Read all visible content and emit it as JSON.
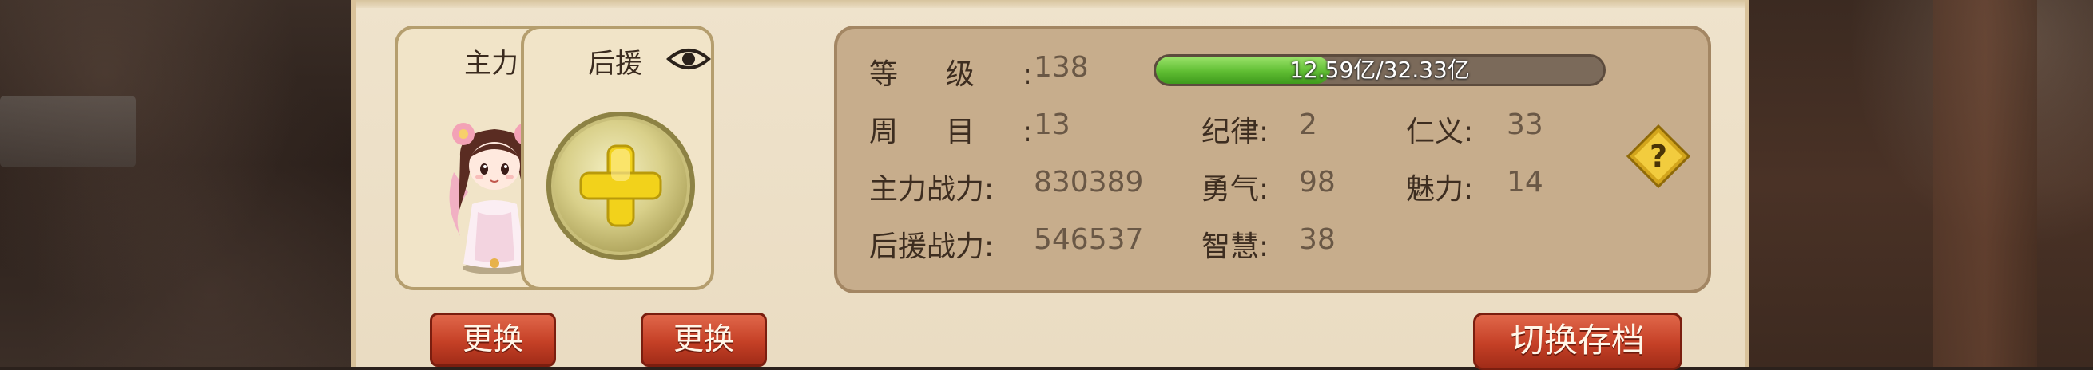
{
  "cards": {
    "main_label": "主力",
    "support_label": "后援"
  },
  "buttons": {
    "change_main": "更换",
    "change_support": "更换",
    "switch_save": "切换存档"
  },
  "stats": {
    "level_label": "等级:",
    "level_value": "138",
    "exp_text": "12.59亿/32.33亿",
    "exp_progress": 0.389,
    "cycle_label": "周目:",
    "cycle_value": "13",
    "discipline_label": "纪律:",
    "discipline_value": "2",
    "benevolence_label": "仁义:",
    "benevolence_value": "33",
    "main_power_label": "主力战力:",
    "main_power_value": "830389",
    "courage_label": "勇气:",
    "courage_value": "98",
    "charm_label": "魅力:",
    "charm_value": "14",
    "support_power_label": "后援战力:",
    "support_power_value": "546537",
    "wisdom_label": "智慧:",
    "wisdom_value": "38"
  },
  "icons": {
    "eye": "eye-icon",
    "plus": "plus-icon",
    "help": "help-icon"
  },
  "colors": {
    "panel_bg": "#efe3cc",
    "stats_bg": "#c7ad8c",
    "button_red": "#c54026",
    "exp_green": "#5fbd32"
  }
}
